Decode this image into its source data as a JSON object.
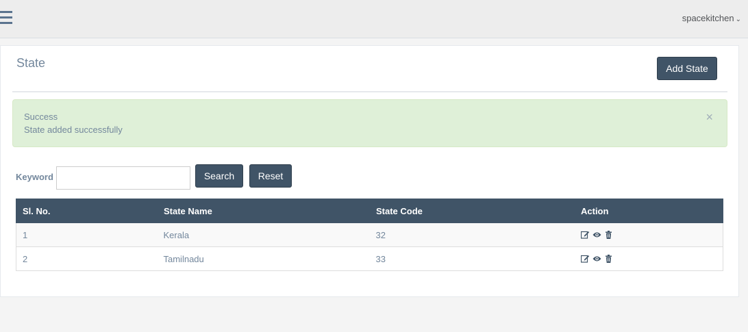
{
  "header": {
    "username": "spacekitchen",
    "caret": "⌄"
  },
  "page": {
    "title": "State",
    "add_button": "Add State"
  },
  "alert": {
    "title": "Success",
    "message": "State added successfully",
    "close": "×"
  },
  "search": {
    "keyword_label": "Keyword",
    "keyword_value": "",
    "search_button": "Search",
    "reset_button": "Reset"
  },
  "table": {
    "columns": [
      "Sl. No.",
      "State Name",
      "State Code",
      "Action"
    ],
    "rows": [
      {
        "sl": "1",
        "name": "Kerala",
        "code": "32",
        "actions": [
          "edit-icon",
          "view-icon",
          "delete-icon"
        ]
      },
      {
        "sl": "2",
        "name": "Tamilnadu",
        "code": "33",
        "actions": [
          "edit-icon",
          "view-icon",
          "delete-icon"
        ]
      }
    ]
  },
  "colors": {
    "primary": "#405467",
    "alert_bg": "#dff0d8",
    "text": "#73879c",
    "topbar": "#ededed"
  }
}
